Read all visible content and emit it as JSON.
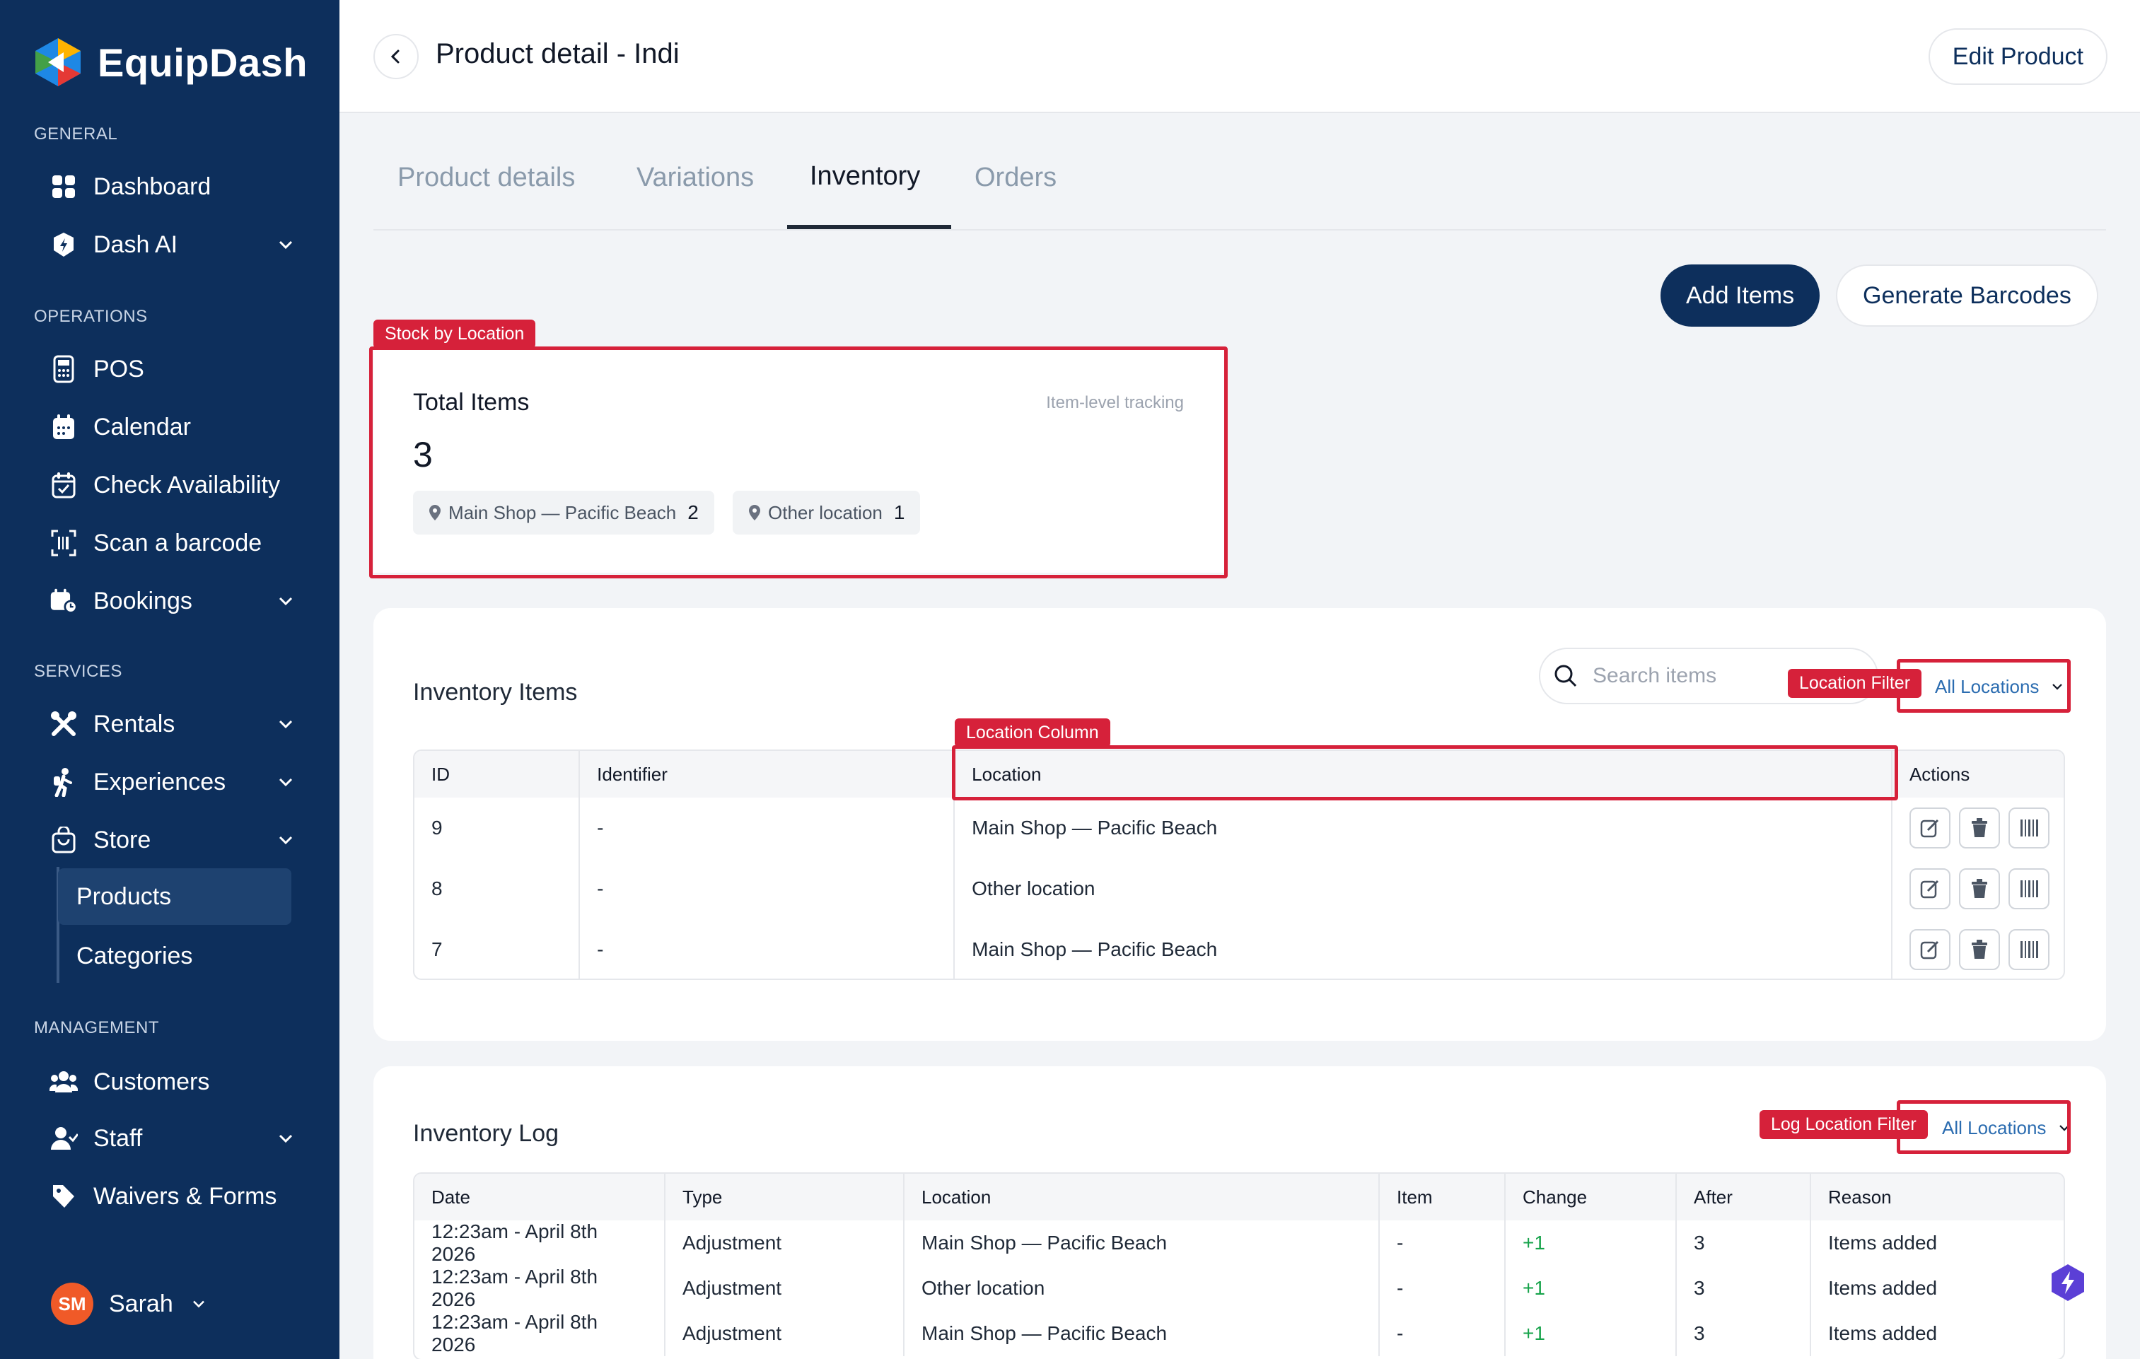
{
  "brand": {
    "name": "EquipDash"
  },
  "sidebar": {
    "sections": [
      {
        "title": "GENERAL"
      },
      {
        "title": "OPERATIONS"
      },
      {
        "title": "SERVICES"
      },
      {
        "title": "MANAGEMENT"
      }
    ],
    "items": {
      "dashboard": "Dashboard",
      "dash_ai": "Dash AI",
      "pos": "POS",
      "calendar": "Calendar",
      "check_availability": "Check Availability",
      "scan_barcode": "Scan a barcode",
      "bookings": "Bookings",
      "rentals": "Rentals",
      "experiences": "Experiences",
      "store": "Store",
      "products": "Products",
      "categories": "Categories",
      "customers": "Customers",
      "staff": "Staff",
      "waivers": "Waivers & Forms"
    },
    "user": {
      "initials": "SM",
      "name": "Sarah"
    }
  },
  "header": {
    "title": "Product detail - Indi",
    "edit_label": "Edit Product"
  },
  "tabs": [
    {
      "label": "Product details",
      "active": false
    },
    {
      "label": "Variations",
      "active": false
    },
    {
      "label": "Inventory",
      "active": true
    },
    {
      "label": "Orders",
      "active": false
    }
  ],
  "actions": {
    "add_items": "Add Items",
    "generate_barcodes": "Generate Barcodes"
  },
  "annotations": {
    "stock_by_location": "Stock by Location",
    "location_filter": "Location Filter",
    "location_column": "Location Column",
    "log_location_filter": "Log Location Filter"
  },
  "stock": {
    "title": "Total Items",
    "note": "Item-level tracking",
    "total": "3",
    "locations": [
      {
        "name": "Main Shop — Pacific Beach",
        "count": "2"
      },
      {
        "name": "Other location",
        "count": "1"
      }
    ]
  },
  "inventory_items": {
    "title": "Inventory Items",
    "search_placeholder": "Search items",
    "location_filter_value": "All Locations",
    "columns": [
      "ID",
      "Identifier",
      "Location",
      "Actions"
    ],
    "rows": [
      {
        "id": "9",
        "identifier": "-",
        "location": "Main Shop — Pacific Beach"
      },
      {
        "id": "8",
        "identifier": "-",
        "location": "Other location"
      },
      {
        "id": "7",
        "identifier": "-",
        "location": "Main Shop — Pacific Beach"
      }
    ]
  },
  "inventory_log": {
    "title": "Inventory Log",
    "location_filter_value": "All Locations",
    "columns": [
      "Date",
      "Type",
      "Location",
      "Item",
      "Change",
      "After",
      "Reason"
    ],
    "rows": [
      {
        "date": "12:23am - April 8th 2026",
        "type": "Adjustment",
        "location": "Main Shop — Pacific Beach",
        "item": "-",
        "change": "+1",
        "after": "3",
        "reason": "Items added"
      },
      {
        "date": "12:23am - April 8th 2026",
        "type": "Adjustment",
        "location": "Other location",
        "item": "-",
        "change": "+1",
        "after": "3",
        "reason": "Items added"
      },
      {
        "date": "12:23am - April 8th 2026",
        "type": "Adjustment",
        "location": "Main Shop — Pacific Beach",
        "item": "-",
        "change": "+1",
        "after": "3",
        "reason": "Items added"
      }
    ]
  },
  "colors": {
    "sidebar": "#0d2f5c",
    "accent": "#d6213a",
    "positive": "#16a34a",
    "link": "#2b6cb0"
  }
}
